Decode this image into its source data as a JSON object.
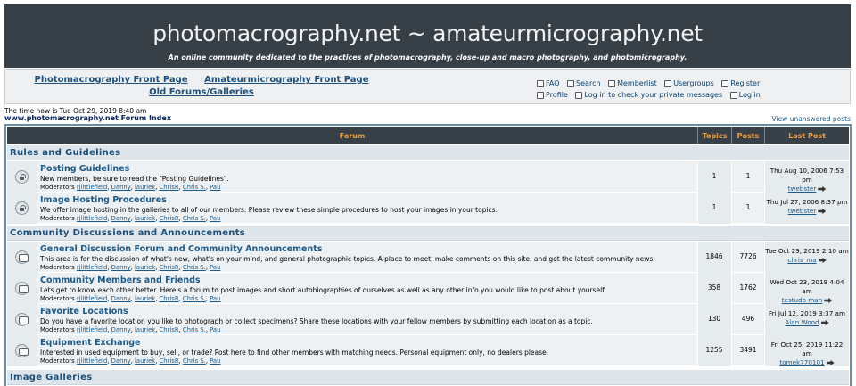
{
  "header": {
    "site_title": "photomacrography.net ~ amateurmicrography.net",
    "tagline": "An online community dedicated to the practices of photomacrography, close-up and macro photography, and photomicrography."
  },
  "nav": {
    "links": [
      "Photomacrography Front Page",
      "Amateurmicrography Front Page",
      "Old Forums/Galleries"
    ]
  },
  "usermenu": {
    "faq": "FAQ",
    "search": "Search",
    "memberlist": "Memberlist",
    "usergroups": "Usergroups",
    "register": "Register",
    "profile": "Profile",
    "messages": "Log in to check your private messages",
    "login": "Log in"
  },
  "status": {
    "time": "The time now is Tue Oct 29, 2019 8:40 am",
    "index_link": "www.photomacrography.net Forum Index",
    "unanswered": "View unanswered posts"
  },
  "table": {
    "headers": {
      "forum": "Forum",
      "topics": "Topics",
      "posts": "Posts",
      "last_post": "Last Post"
    },
    "categories": [
      "Rules and Guidelines",
      "Community Discussions and Announcements",
      "Image Galleries"
    ],
    "moderators_label": "Moderators",
    "moderators": [
      "rjlittlefield",
      "Danny",
      "lauriek",
      "ChrisR",
      "Chris S.",
      "Pau"
    ],
    "forums": [
      {
        "name": "Posting Guidelines",
        "desc": "New members, be sure to read the \"Posting Guidelines\".",
        "topics": "1",
        "posts": "1",
        "last_date": "Thu Aug 10, 2006 7:53 pm",
        "last_user": "twebster",
        "icon": "lock-icon"
      },
      {
        "name": "Image Hosting Procedures",
        "desc": "We offer image hosting in the galleries to all of our members. Please review these simple procedures to host your images in your topics.",
        "topics": "1",
        "posts": "1",
        "last_date": "Thu Jul 27, 2006 8:37 pm",
        "last_user": "twebster",
        "icon": "lock-icon"
      },
      {
        "name": "General Discussion Forum and Community Announcements",
        "desc": "This area is for the discussion of what's new, what's on your mind, and general photographic topics. A place to meet, make comments on this site, and get the latest community news.",
        "topics": "1846",
        "posts": "7726",
        "last_date": "Tue Oct 29, 2019 2:10 am",
        "last_user": "chris_ma",
        "icon": "forum-icon"
      },
      {
        "name": "Community Members and Friends",
        "desc": "Lets get to know each other better. Here's a forum to post images and short autobiographies of ourselves as well as any other info you would like to post about yourself.",
        "topics": "358",
        "posts": "1762",
        "last_date": "Wed Oct 23, 2019 4:04 am",
        "last_user": "testudo man",
        "icon": "forum-icon"
      },
      {
        "name": "Favorite Locations",
        "desc": "Do you have a favorite location you like to photograph or collect specimens? Share these locations with your fellow members by submitting each location as a topic.",
        "topics": "130",
        "posts": "496",
        "last_date": "Fri Jul 12, 2019 3:37 am",
        "last_user": "Alan Wood",
        "icon": "forum-icon"
      },
      {
        "name": "Equipment Exchange",
        "desc": "Interested in used equipment to buy, sell, or trade? Post here to find other members with matching needs. Personal equipment only, no dealers please.",
        "topics": "1255",
        "posts": "3491",
        "last_date": "Fri Oct 25, 2019 11:22 am",
        "last_user": "tomek770101",
        "icon": "forum-icon"
      }
    ]
  }
}
